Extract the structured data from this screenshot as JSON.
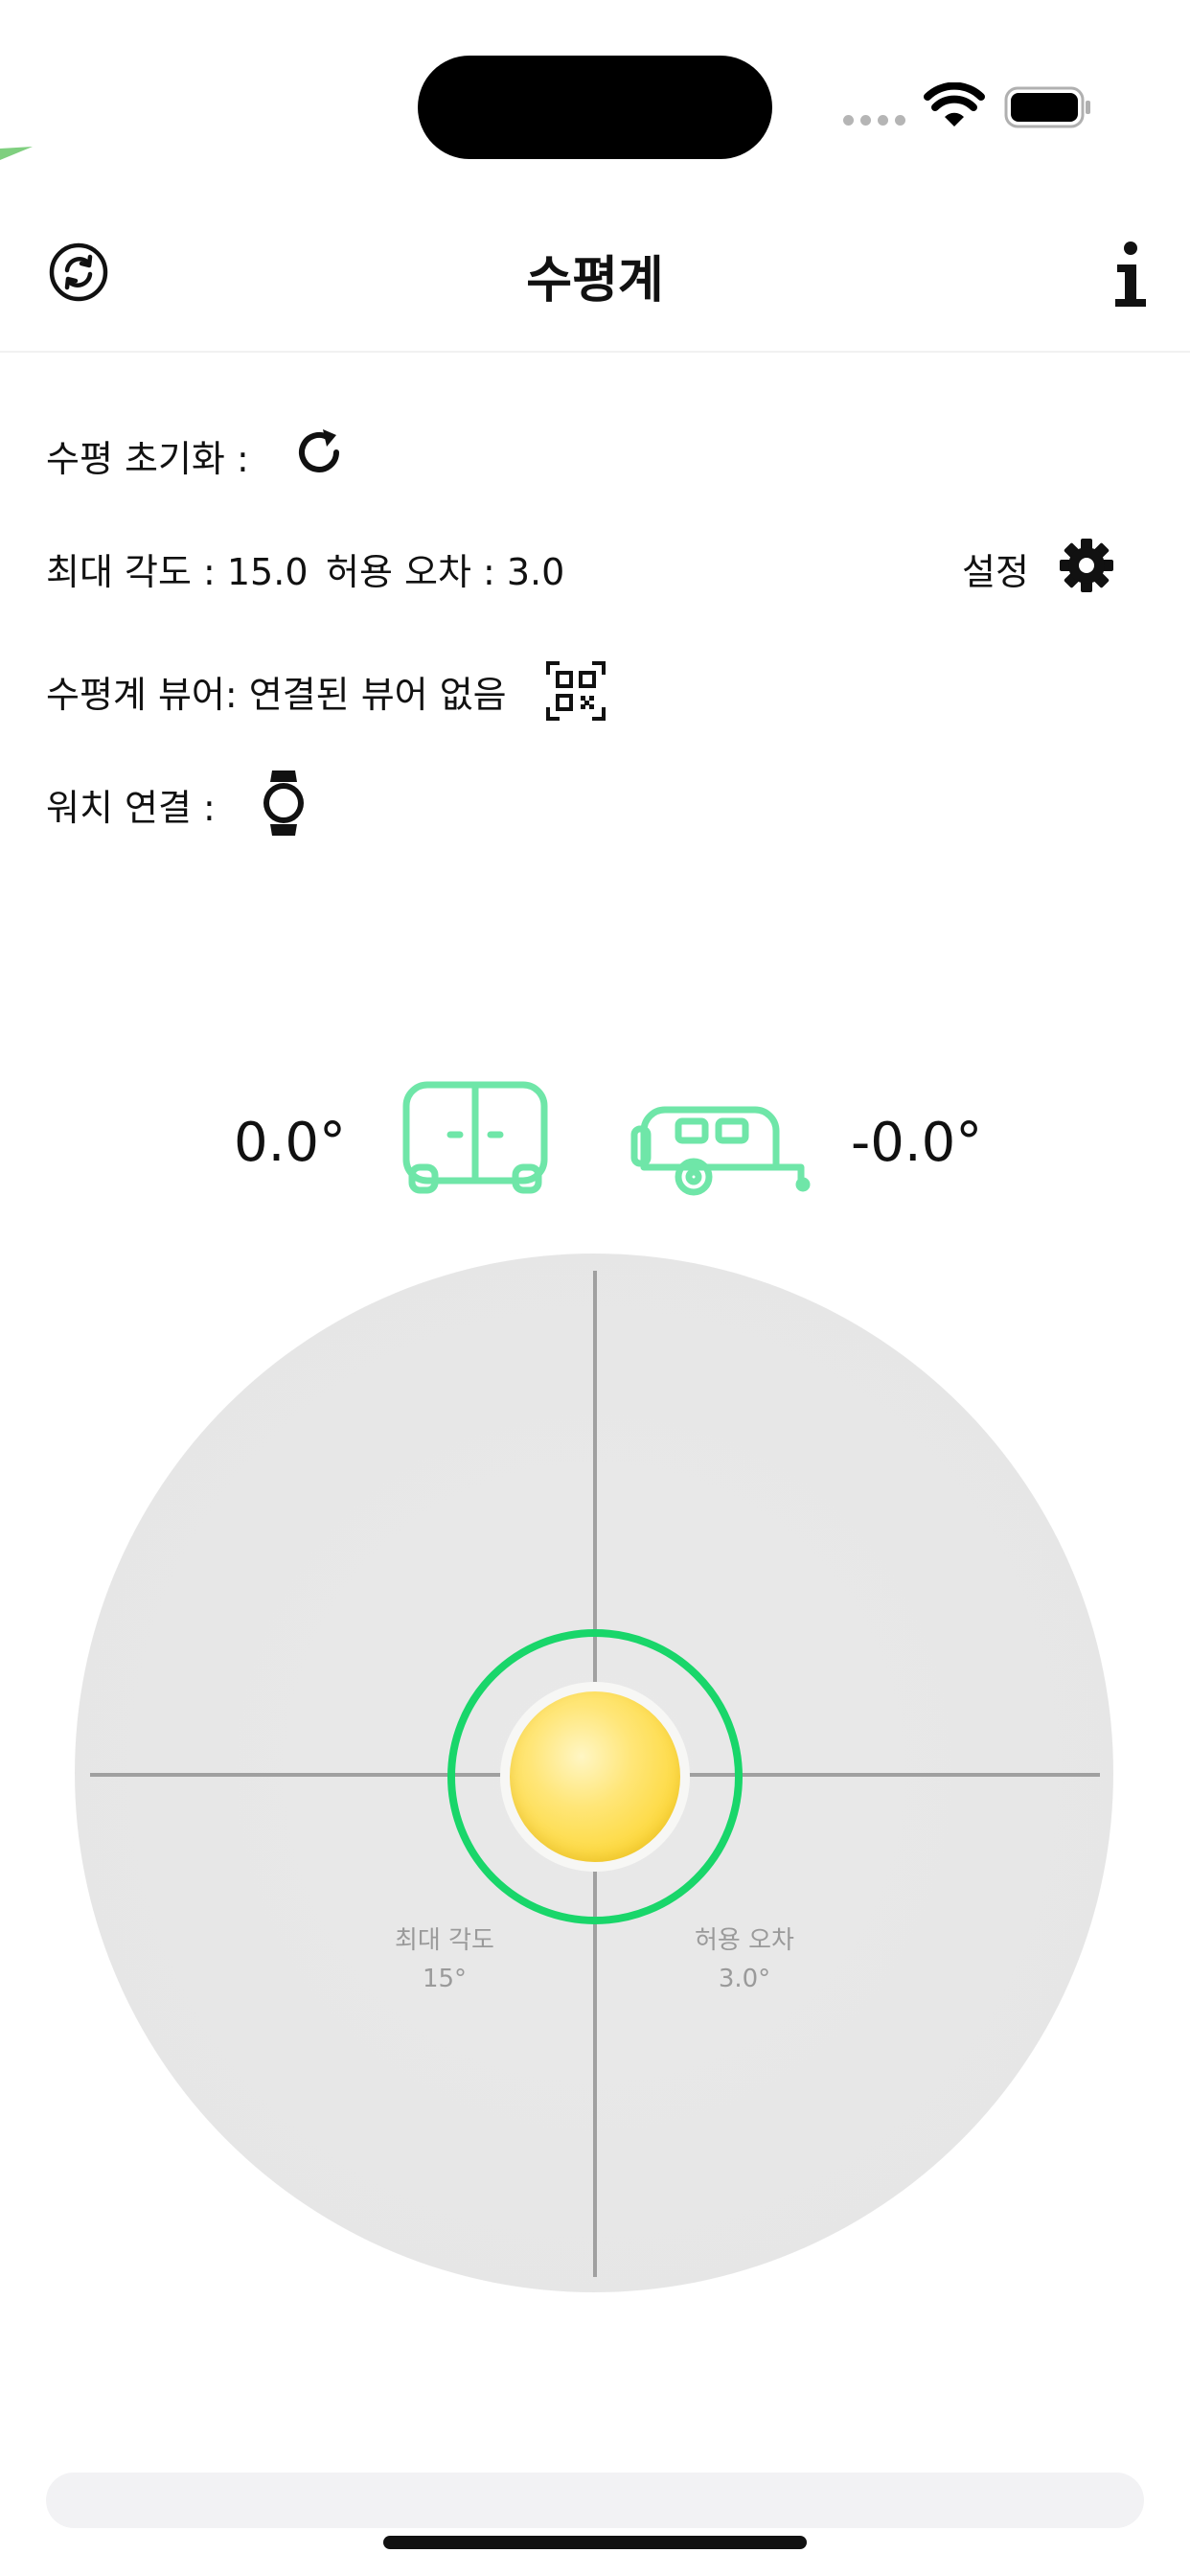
{
  "header": {
    "title": "수평계",
    "left_icon": "sync-circle-icon",
    "right_icon": "info-icon"
  },
  "rows": {
    "reset_label": "수평 초기화 :",
    "max_angle_text": "최대 각도 : 15.0",
    "tolerance_text": "허용 오차 : 3.0",
    "settings_label": "설정",
    "viewer_text": "수평계 뷰어: 연결된 뷰어 없음",
    "watch_label": "워치 연결 :"
  },
  "readouts": {
    "front_angle": "0.0°",
    "side_angle": "-0.0°"
  },
  "level": {
    "max_angle_label": "최대 각도",
    "max_angle_value": "15°",
    "tolerance_label": "허용 오차",
    "tolerance_value": "3.0°"
  },
  "colors": {
    "accent_green": "#19d66a",
    "vehicle_icon_green": "#6fe6a8",
    "bubble_yellow": "#fdd83a"
  }
}
